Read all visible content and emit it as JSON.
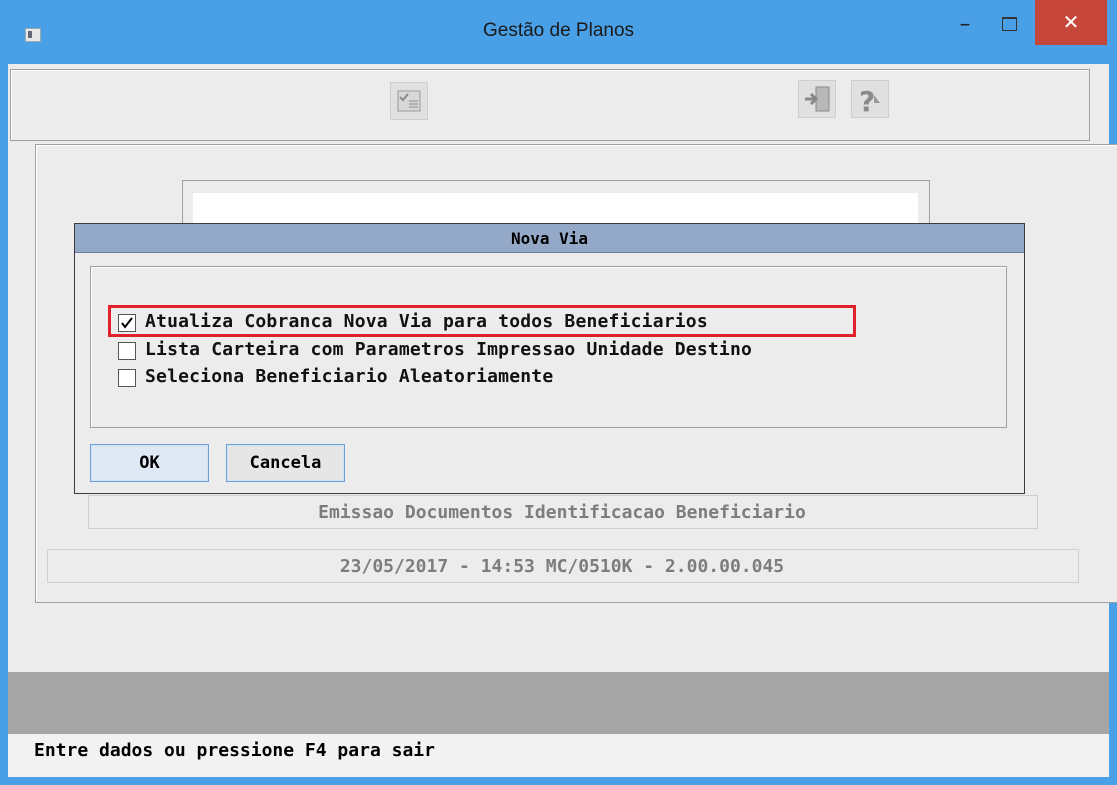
{
  "window": {
    "title": "Gestão de Planos",
    "minimize_glyph": "–",
    "close_glyph": "✕"
  },
  "toolbar": {
    "icons": [
      "checklist-icon",
      "exit-door-icon",
      "help-icon"
    ]
  },
  "dialog": {
    "title": "Nova Via",
    "options": [
      {
        "label": "Atualiza Cobranca Nova Via para todos Beneficiarios",
        "checked": true,
        "highlighted": true
      },
      {
        "label": "Lista Carteira com Parametros Impressao Unidade Destino",
        "checked": false
      },
      {
        "label": "Seleciona Beneficiario Aleatoriamente",
        "checked": false
      }
    ],
    "ok_label": "OK",
    "cancel_label": "Cancela"
  },
  "program_description": "Emissao Documentos Identificacao Beneficiario",
  "program_info": "23/05/2017 - 14:53  MC/0510K - 2.00.00.045",
  "status_bar": {
    "message": "Entre dados ou pressione F4 para sair"
  },
  "colors": {
    "title_bar": "#4aa0e6",
    "close_button": "#c7463a",
    "dialog_title": "#94a8c8",
    "highlight_box": "#e0202a"
  }
}
